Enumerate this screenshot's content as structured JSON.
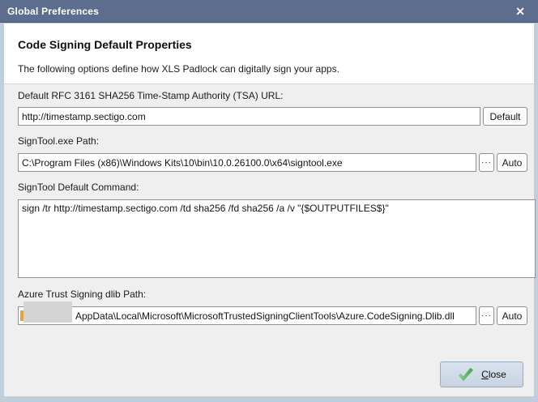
{
  "window": {
    "title": "Global Preferences",
    "close_glyph": "✕"
  },
  "header": {
    "title": "Code Signing Default Properties",
    "description": "The following options define how XLS Padlock can digitally sign your apps."
  },
  "fields": {
    "tsa": {
      "label": "Default RFC 3161 SHA256 Time-Stamp Authority (TSA) URL:",
      "value": "http://timestamp.sectigo.com",
      "default_button": "Default"
    },
    "signtool_path": {
      "label": "SignTool.exe Path:",
      "value": "C:\\Program Files (x86)\\Windows Kits\\10\\bin\\10.0.26100.0\\x64\\signtool.exe",
      "browse_button": "···",
      "auto_button": "Auto"
    },
    "command": {
      "label": "SignTool Default Command:",
      "value": "sign /tr http://timestamp.sectigo.com /td sha256 /fd sha256 /a /v \"{$OUTPUTFILES$}\""
    },
    "azure_dlib": {
      "label": "Azure Trust Signing dlib Path:",
      "value": "AppData\\Local\\Microsoft\\MicrosoftTrustedSigningClientTools\\Azure.CodeSigning.Dlib.dll",
      "redacted_prefix": "user profile path hidden",
      "browse_button": "···",
      "auto_button": "Auto"
    }
  },
  "footer": {
    "close_accel": "C",
    "close_rest": "lose"
  },
  "colors": {
    "titlebar": "#5d6d8e",
    "header_bg": "#ffffff",
    "body_bg": "#efefef",
    "window_border": "#bfcddd",
    "check_green": "#4fae58"
  }
}
